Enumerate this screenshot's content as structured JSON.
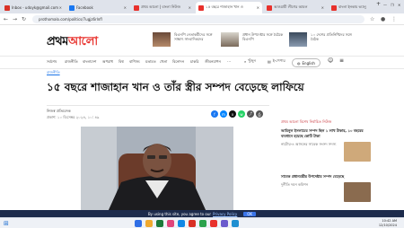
{
  "browser": {
    "tabs": [
      {
        "label": "Inbox - udoyk@gmail.com",
        "favicon_color": "#d93025",
        "active": false
      },
      {
        "label": "Facebook",
        "favicon_color": "#1877f2",
        "active": false
      },
      {
        "label": "প্রথম আলো | বাংলা নিউজ",
        "favicon_color": "#e8312c",
        "active": false
      },
      {
        "label": "১৫ বছরে শাজাহান খান ও",
        "favicon_color": "#e8312c",
        "active": true
      },
      {
        "label": "আওয়ামী লীগের আমল",
        "favicon_color": "#e8312c",
        "active": false
      },
      {
        "label": "বাংলা ইনকাম ভ্যালু",
        "favicon_color": "#e8312c",
        "active": false
      }
    ],
    "url": "prothomalo.com/politics/7ugjz6rlnfl",
    "new_tab": "+",
    "controls": [
      "—",
      "❐",
      "✕"
    ]
  },
  "site": {
    "logo_main": "প্রথম",
    "logo_accent": "আলো",
    "promos": [
      {
        "text": "বিএনপি নেতাকর্মীদের সঙ্গে সাক্ষাৎ সাংবাদিকদের"
      },
      {
        "text": "প্রধান উপদেষ্টার সঙ্গে বৈঠকে বিএনপি"
      },
      {
        "text": "১০ দেশের প্রতিনিধিদের সঙ্গে বৈঠক"
      }
    ],
    "menu": [
      "সর্বশেষ",
      "রাজনীতি",
      "বাংলাদেশ",
      "অপরাধ",
      "বিশ্ব",
      "বাণিজ্য",
      "মতামত",
      "খেলা",
      "বিনোদন",
      "চাকরি",
      "জীবনযাপন"
    ],
    "search_label": "খুঁজুন",
    "epaper_label": "ই-পেপার",
    "language_label": "English",
    "section": "রাজনীতি",
    "headline": "১৫ বছরে শাজাহান খান ও তাঁর স্ত্রীর সম্পদ বেড়েছে লাফিয়ে",
    "byline": "নিজস্ব প্রতিবেদক",
    "date": "প্রকাশ: ১০ ডিসেম্বর ২০২৪, ১০: ৪৯",
    "share_icons": [
      {
        "name": "facebook-icon",
        "glyph": "f",
        "color": "#1877f2"
      },
      {
        "name": "messenger-icon",
        "glyph": "m",
        "color": "#0084ff"
      },
      {
        "name": "x-icon",
        "glyph": "x",
        "color": "#111111"
      },
      {
        "name": "whatsapp-icon",
        "glyph": "w",
        "color": "#25d366"
      },
      {
        "name": "share-icon",
        "glyph": "⤴",
        "color": "#555555"
      },
      {
        "name": "print-icon",
        "glyph": "⎙",
        "color": "#555555"
      }
    ],
    "sidebar": {
      "heading": "প্রথম আলো বিশেষ নির্বাচিত নিউজ",
      "items": [
        {
          "title": "আমিনুল ইসলামের সম্পদ ছিল ১ লাখ টাকার, ১০ বছরের ব্যবধানে হয়েছে কোটি টাকা",
          "meta": "নাটোর-৪ আসনের সাবেক সংসদ সদস্য",
          "thumb_color": "#cfa97a"
        },
        {
          "title": "সাবেক প্রধানমন্ত্রীর উপদেষ্টার সম্পদ বেড়েছে",
          "meta": "দুর্নীতি দমন কমিশন",
          "thumb_color": "#8a6b4f"
        }
      ]
    },
    "consent": {
      "text": "By using this site, you agree to our",
      "link": "Privacy Policy",
      "button": "OK"
    }
  },
  "taskbar": {
    "time": "10:42 AM",
    "date": "12/10/2024",
    "icons": [
      "#2f6ee5",
      "#f0a92f",
      "#1d7a3a",
      "#e0457b",
      "#0f88e6",
      "#d93025",
      "#2ba24c",
      "#e8312c",
      "#6a5acd",
      "#1f8fd1"
    ]
  }
}
